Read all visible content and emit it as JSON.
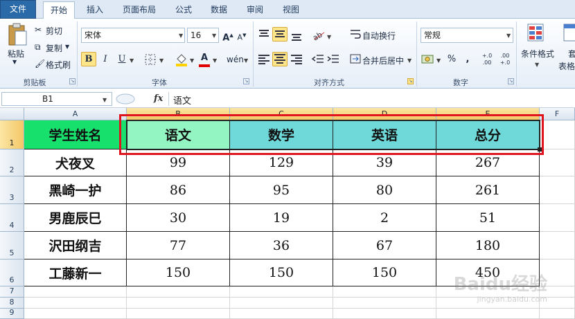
{
  "tabs": [
    "文件",
    "开始",
    "插入",
    "页面布局",
    "公式",
    "数据",
    "审阅",
    "视图"
  ],
  "active_tab": "开始",
  "clipboard": {
    "paste_label": "粘贴",
    "cut_label": "剪切",
    "copy_label": "复制",
    "format_painter_label": "格式刷",
    "group_label": "剪贴板"
  },
  "font": {
    "name": "宋体",
    "size": "16",
    "bold": "B",
    "italic": "I",
    "underline": "U",
    "grow": "A",
    "shrink": "A",
    "font_color_letter": "A",
    "group_label": "字体"
  },
  "alignment": {
    "wrap_text_label": "自动换行",
    "merge_center_label": "合并后居中",
    "group_label": "对齐方式"
  },
  "number": {
    "format_value": "常规",
    "percent": "%",
    "comma": ",",
    "inc_decimal": "+.0 .00",
    "dec_decimal": ".00 +.0",
    "group_label": "数字"
  },
  "styles": {
    "conditional_format_label": "条件格式",
    "table_format_label_top": "套",
    "table_format_label_bottom": "表格"
  },
  "formula_bar": {
    "name_box": "B1",
    "fx": "fx",
    "content": "语文"
  },
  "columns": [
    "A",
    "B",
    "C",
    "D",
    "E",
    "F"
  ],
  "rows": [
    "1",
    "2",
    "3",
    "4",
    "5",
    "6",
    "7",
    "8",
    "9"
  ],
  "table": {
    "header": [
      "学生姓名",
      "语文",
      "数学",
      "英语",
      "总分"
    ],
    "rows": [
      [
        "犬夜叉",
        "99",
        "129",
        "39",
        "267"
      ],
      [
        "黑崎一护",
        "86",
        "95",
        "80",
        "261"
      ],
      [
        "男鹿辰巳",
        "30",
        "19",
        "2",
        "51"
      ],
      [
        "沢田纲吉",
        "77",
        "36",
        "67",
        "180"
      ],
      [
        "工藤新一",
        "150",
        "150",
        "150",
        "450"
      ]
    ]
  },
  "colors": {
    "name_header_fill": "#17e06c",
    "active_cell_fill": "#93f5c2",
    "subject_header_fill": "#6fd8d8",
    "highlight_border": "#e0141e"
  },
  "watermark": {
    "main": "Baidu经验",
    "sub": "jingyan.baidu.com"
  }
}
